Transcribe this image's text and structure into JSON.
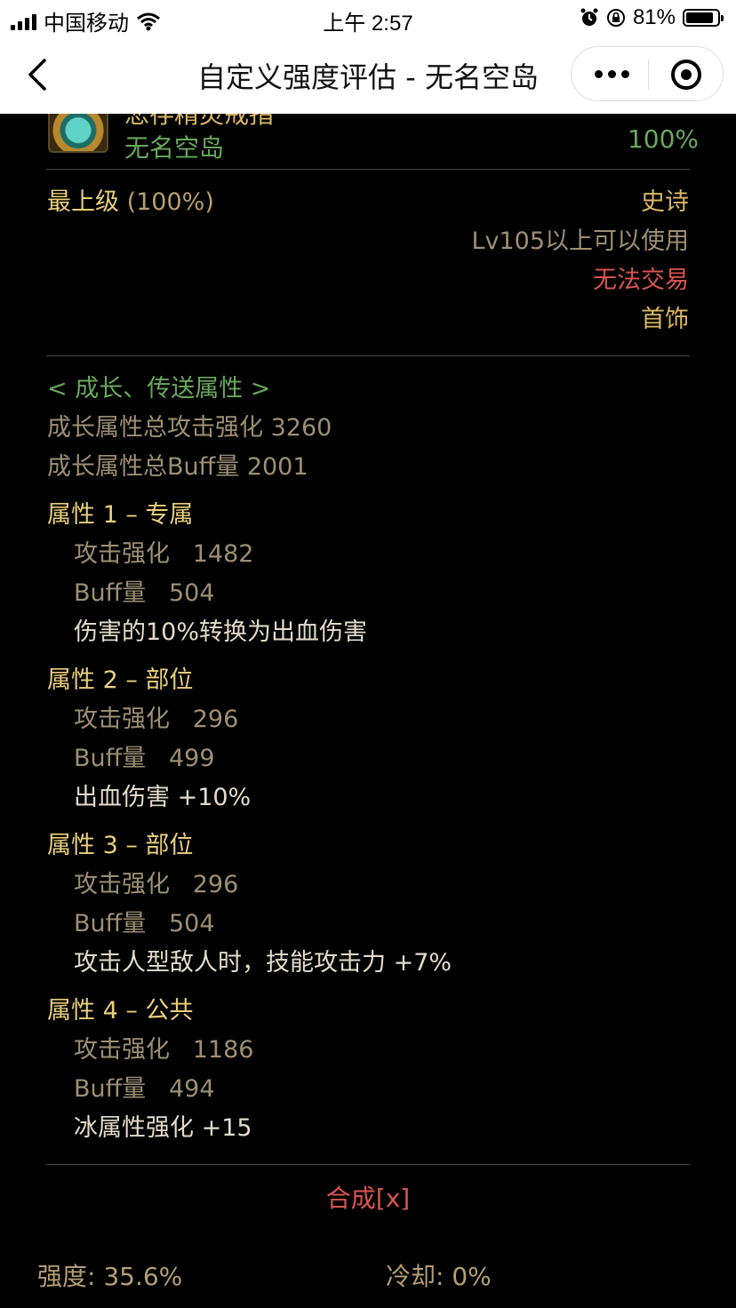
{
  "status_bar": {
    "carrier": "中国移动",
    "time": "上午 2:57",
    "battery": "81%"
  },
  "nav": {
    "title": "自定义强度评估 - 无名空岛"
  },
  "item": {
    "name_partial": "悲存精灵戒指",
    "source": "无名空岛",
    "percent": "100%"
  },
  "tier": {
    "label": "最上级",
    "percent": "(100%)",
    "rarity": "史诗",
    "level_req": "Lv105以上可以使用",
    "trade": "无法交易",
    "slot": "首饰"
  },
  "growth": {
    "header": "< 成长、传送属性 >",
    "total_attack": "成长属性总攻击强化 3260",
    "total_buff": "成长属性总Buff量 2001",
    "attributes": [
      {
        "title": "属性 1 – 专属",
        "attack": "攻击强化   1482",
        "buff": "Buff量   504",
        "effect": "伤害的10%转换为出血伤害"
      },
      {
        "title": "属性 2 – 部位",
        "attack": "攻击强化   296",
        "buff": "Buff量   499",
        "effect": "出血伤害 +10%"
      },
      {
        "title": "属性 3 – 部位",
        "attack": "攻击强化   296",
        "buff": "Buff量   504",
        "effect": "攻击人型敌人时，技能攻击力 +7%"
      },
      {
        "title": "属性 4 – 公共",
        "attack": "攻击强化   1186",
        "buff": "Buff量   494",
        "effect": "冰属性强化 +15"
      }
    ]
  },
  "synthesis": "合成[x]",
  "footer": {
    "strength": "强度: 35.6%",
    "cooldown": "冷却: 0%"
  }
}
